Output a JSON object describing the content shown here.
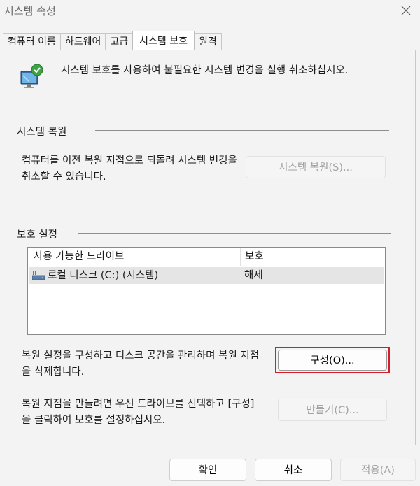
{
  "window": {
    "title": "시스템 속성"
  },
  "tabs": [
    {
      "label": "컴퓨터 이름",
      "active": false
    },
    {
      "label": "하드웨어",
      "active": false
    },
    {
      "label": "고급",
      "active": false
    },
    {
      "label": "시스템 보호",
      "active": true
    },
    {
      "label": "원격",
      "active": false
    }
  ],
  "intro": {
    "icon": "system-protection-icon",
    "text": "시스템 보호를 사용하여 불필요한 시스템 변경을 실행 취소하십시오."
  },
  "restore": {
    "section_label": "시스템 복원",
    "description": "컴퓨터를 이전 복원 지점으로 되돌려 시스템 변경을 취소할 수 있습니다.",
    "button_label": "시스템 복원(S)..."
  },
  "protection": {
    "section_label": "보호 설정",
    "columns": {
      "drive": "사용 가능한 드라이브",
      "protection": "보호"
    },
    "drives": [
      {
        "name": "로컬 디스크 (C:) (시스템)",
        "protection": "해제",
        "icon": "drive-icon"
      }
    ],
    "configure_description": "복원 설정을 구성하고 디스크 공간을 관리하며 복원 지점을 삭제합니다.",
    "configure_button": "구성(O)...",
    "create_description": "복원 지점을 만들려면 우선 드라이브를 선택하고 [구성]을 클릭하여 보호를 설정하십시오.",
    "create_button": "만들기(C)..."
  },
  "footer": {
    "ok": "확인",
    "cancel": "취소",
    "apply": "적용(A)"
  },
  "colors": {
    "highlight": "#d21f2a",
    "disabled_text": "#a3a3a3"
  }
}
